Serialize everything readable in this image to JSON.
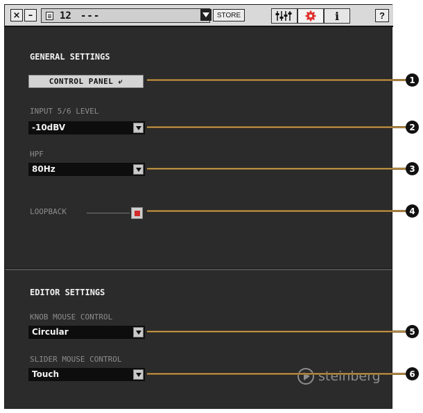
{
  "toolbar": {
    "close_label": "×",
    "minimize_label": "–",
    "scene_number": "12",
    "scene_name": "---",
    "store_label": "STORE",
    "info_label": "i",
    "help_label": "?"
  },
  "general": {
    "title": "GENERAL SETTINGS",
    "control_panel_label": "CONTROL PANEL ⤶",
    "input_level": {
      "label": "INPUT 5/6 LEVEL",
      "value": "-10dBV"
    },
    "hpf": {
      "label": "HPF",
      "value": "80Hz"
    },
    "loopback": {
      "label": "LOOPBACK",
      "checked": true
    }
  },
  "editor": {
    "title": "EDITOR SETTINGS",
    "knob": {
      "label": "KNOB MOUSE CONTROL",
      "value": "Circular"
    },
    "slider": {
      "label": "SLIDER MOUSE CONTROL",
      "value": "Touch"
    }
  },
  "brand": {
    "name": "steinberg"
  },
  "callouts": [
    "1",
    "2",
    "3",
    "4",
    "5",
    "6"
  ],
  "colors": {
    "panel_bg": "#2b2b2b",
    "callout_line": "#d8a95c",
    "loopback_on": "#d12a2a",
    "settings_gear": "#e0322e"
  }
}
